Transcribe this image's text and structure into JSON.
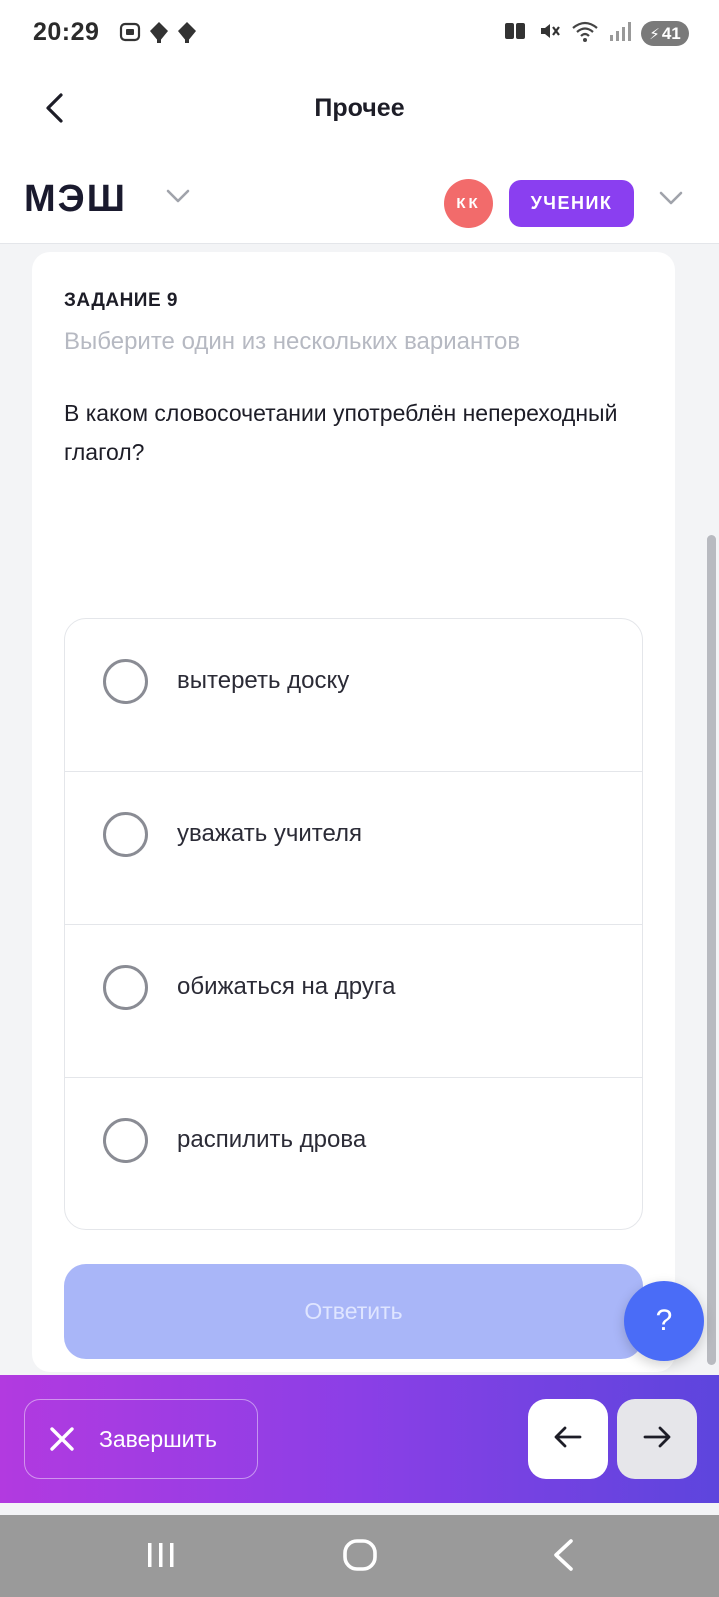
{
  "status_bar": {
    "time": "20:29",
    "battery_text": "41",
    "left_icons": [
      "screenshot-icon",
      "notification-icon",
      "notification-icon"
    ],
    "right_icons": [
      "book-icon",
      "mute-icon",
      "wifi-icon",
      "signal-icon"
    ]
  },
  "title_bar": {
    "title": "Прочее",
    "back_icon": "chevron-left-icon"
  },
  "app_header": {
    "brand": "МЭШ",
    "avatar_initials": "КК",
    "role": "УЧЕНИК"
  },
  "task": {
    "label": "ЗАДАНИЕ 9",
    "hint": "Выберите один из нескольких вариантов",
    "question": "В каком словосочетании употреблён непереходный глагол?",
    "options": [
      {
        "label": "вытереть доску",
        "selected": false
      },
      {
        "label": "уважать учителя",
        "selected": false
      },
      {
        "label": "обижаться на друга",
        "selected": false
      },
      {
        "label": "распилить дрова",
        "selected": false
      }
    ],
    "answer_label": "Ответить"
  },
  "help": {
    "label": "?"
  },
  "action_bar": {
    "finish_label": "Завершить"
  },
  "colors": {
    "accent": "#8a3ff0",
    "answer_disabled": "#a9b6f8",
    "help": "#4a6cf7",
    "avatar": "#f26b6b"
  }
}
